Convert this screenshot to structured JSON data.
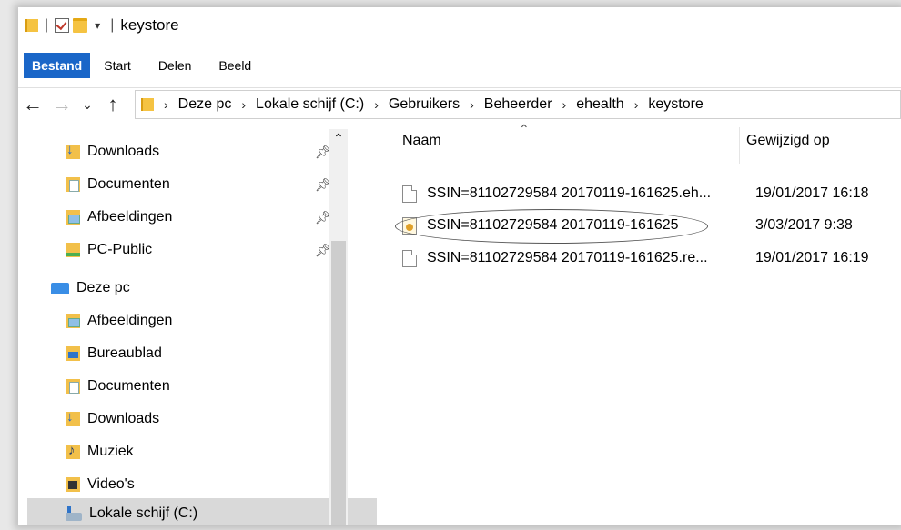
{
  "window": {
    "title": "keystore"
  },
  "ribbon": {
    "tabs": [
      "Bestand",
      "Start",
      "Delen",
      "Beeld"
    ]
  },
  "address": {
    "breadcrumbs": [
      "Deze pc",
      "Lokale schijf (C:)",
      "Gebruikers",
      "Beheerder",
      "ehealth",
      "keystore"
    ]
  },
  "sidebar": {
    "quick_access": [
      {
        "label": "Downloads",
        "icon": "downloads-folder-icon",
        "pinned": true
      },
      {
        "label": "Documenten",
        "icon": "documents-folder-icon",
        "pinned": true
      },
      {
        "label": "Afbeeldingen",
        "icon": "pictures-folder-icon",
        "pinned": true
      },
      {
        "label": "PC-Public",
        "icon": "public-folder-icon",
        "pinned": true
      }
    ],
    "this_pc": {
      "label": "Deze pc",
      "icon": "computer-icon"
    },
    "pc_items": [
      {
        "label": "Afbeeldingen",
        "icon": "pictures-folder-icon"
      },
      {
        "label": "Bureaublad",
        "icon": "desktop-folder-icon"
      },
      {
        "label": "Documenten",
        "icon": "documents-folder-icon"
      },
      {
        "label": "Downloads",
        "icon": "downloads-folder-icon"
      },
      {
        "label": "Muziek",
        "icon": "music-folder-icon"
      },
      {
        "label": "Video's",
        "icon": "videos-folder-icon"
      },
      {
        "label": "Lokale schijf (C:)",
        "icon": "drive-icon",
        "selected": true
      }
    ]
  },
  "files": {
    "columns": {
      "name": "Naam",
      "modified": "Gewijzigd op"
    },
    "rows": [
      {
        "name": "SSIN=81102729584 20170119-161625.eh...",
        "modified": "19/01/2017 16:18",
        "icon": "file-icon"
      },
      {
        "name": "SSIN=81102729584 20170119-161625",
        "modified": "3/03/2017 9:38",
        "icon": "certificate-file-icon",
        "highlighted": true
      },
      {
        "name": "SSIN=81102729584 20170119-161625.re...",
        "modified": "19/01/2017 16:19",
        "icon": "file-icon"
      }
    ]
  }
}
